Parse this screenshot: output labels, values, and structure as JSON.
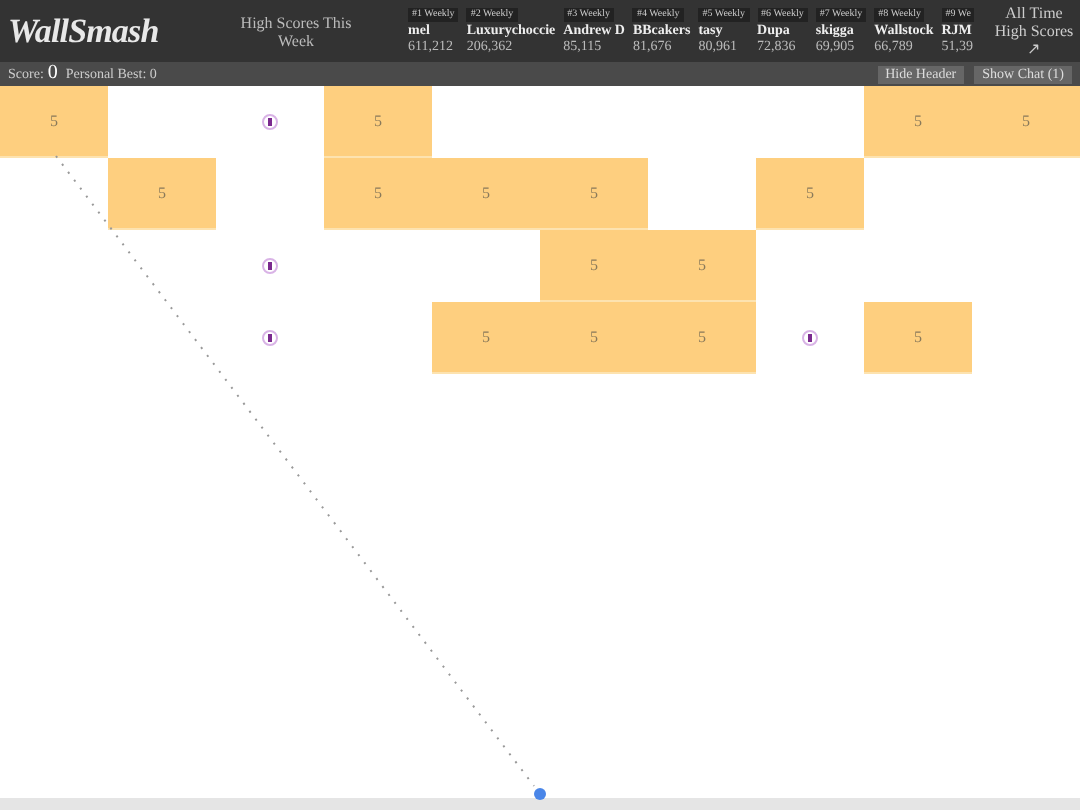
{
  "header": {
    "logo": "WallSmash",
    "high_scores_label": "High Scores This Week",
    "weekly_scores": [
      {
        "rank": "#1 Weekly",
        "name": "mel",
        "score": "611,212"
      },
      {
        "rank": "#2 Weekly",
        "name": "Luxurychoccie",
        "score": "206,362"
      },
      {
        "rank": "#3 Weekly",
        "name": "Andrew D",
        "score": "85,115"
      },
      {
        "rank": "#4 Weekly",
        "name": "BBcakers",
        "score": "81,676"
      },
      {
        "rank": "#5 Weekly",
        "name": "tasy",
        "score": "80,961"
      },
      {
        "rank": "#6 Weekly",
        "name": "Dupa",
        "score": "72,836"
      },
      {
        "rank": "#7 Weekly",
        "name": "skigga",
        "score": "69,905"
      },
      {
        "rank": "#8 Weekly",
        "name": "Wallstock",
        "score": "66,789"
      },
      {
        "rank": "#9 We",
        "name": "RJM",
        "score": "51,39"
      }
    ],
    "all_time_link": "All Time High Scores ↗"
  },
  "status_bar": {
    "score_label": "Score:",
    "score": "0",
    "personal_best": "Personal Best: 0",
    "buttons": [
      "Hide Header",
      "Show Chat (1)"
    ]
  },
  "board": {
    "rows": [
      [
        {
          "kind": "brick",
          "label": "5"
        },
        {
          "kind": "empty"
        },
        {
          "kind": "ball"
        },
        {
          "kind": "brick",
          "label": "5"
        },
        {
          "kind": "empty"
        },
        {
          "kind": "empty"
        },
        {
          "kind": "empty"
        },
        {
          "kind": "empty"
        },
        {
          "kind": "brick",
          "label": "5"
        },
        {
          "kind": "brick",
          "label": "5"
        }
      ],
      [
        {
          "kind": "empty"
        },
        {
          "kind": "brick",
          "label": "5"
        },
        {
          "kind": "empty"
        },
        {
          "kind": "brick",
          "label": "5"
        },
        {
          "kind": "brick",
          "label": "5"
        },
        {
          "kind": "brick",
          "label": "5"
        },
        {
          "kind": "empty"
        },
        {
          "kind": "brick",
          "label": "5"
        },
        {
          "kind": "empty"
        },
        {
          "kind": "empty"
        }
      ],
      [
        {
          "kind": "empty"
        },
        {
          "kind": "empty"
        },
        {
          "kind": "ball"
        },
        {
          "kind": "empty"
        },
        {
          "kind": "empty"
        },
        {
          "kind": "brick",
          "label": "5"
        },
        {
          "kind": "brick",
          "label": "5"
        },
        {
          "kind": "empty"
        },
        {
          "kind": "empty"
        },
        {
          "kind": "empty"
        }
      ],
      [
        {
          "kind": "empty"
        },
        {
          "kind": "empty"
        },
        {
          "kind": "ball"
        },
        {
          "kind": "empty"
        },
        {
          "kind": "brick",
          "label": "5"
        },
        {
          "kind": "brick",
          "label": "5"
        },
        {
          "kind": "brick",
          "label": "5"
        },
        {
          "kind": "ball"
        },
        {
          "kind": "brick",
          "label": "5"
        },
        {
          "kind": "empty"
        }
      ]
    ]
  }
}
